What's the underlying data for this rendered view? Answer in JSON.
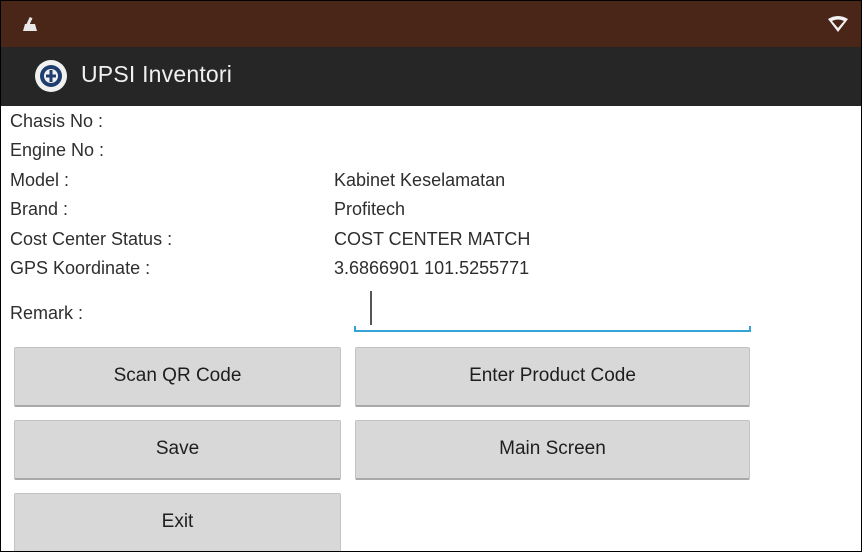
{
  "status_bar": {
    "left_icon": "cleaning-broom-icon",
    "right_icon": "wifi-signal-icon",
    "background": "#4a2618"
  },
  "action_bar": {
    "title": "UPSI Inventori",
    "logo_icon": "upsi-crest-icon",
    "background": "#262626"
  },
  "fields": [
    {
      "label": "Chasis No :",
      "value": ""
    },
    {
      "label": "Engine No :",
      "value": ""
    },
    {
      "label": "Model :",
      "value": "Kabinet Keselamatan"
    },
    {
      "label": "Brand :",
      "value": "Profitech"
    },
    {
      "label": "Cost Center Status :",
      "value": "COST CENTER MATCH"
    },
    {
      "label": "GPS Koordinate :",
      "value": "3.6866901  101.5255771"
    }
  ],
  "remark": {
    "label": "Remark :",
    "value": "",
    "accent": "#33a3d6"
  },
  "buttons": {
    "scan_qr": "Scan QR Code",
    "enter_product": "Enter Product Code",
    "save": "Save",
    "main_screen": "Main Screen",
    "exit": "Exit"
  }
}
